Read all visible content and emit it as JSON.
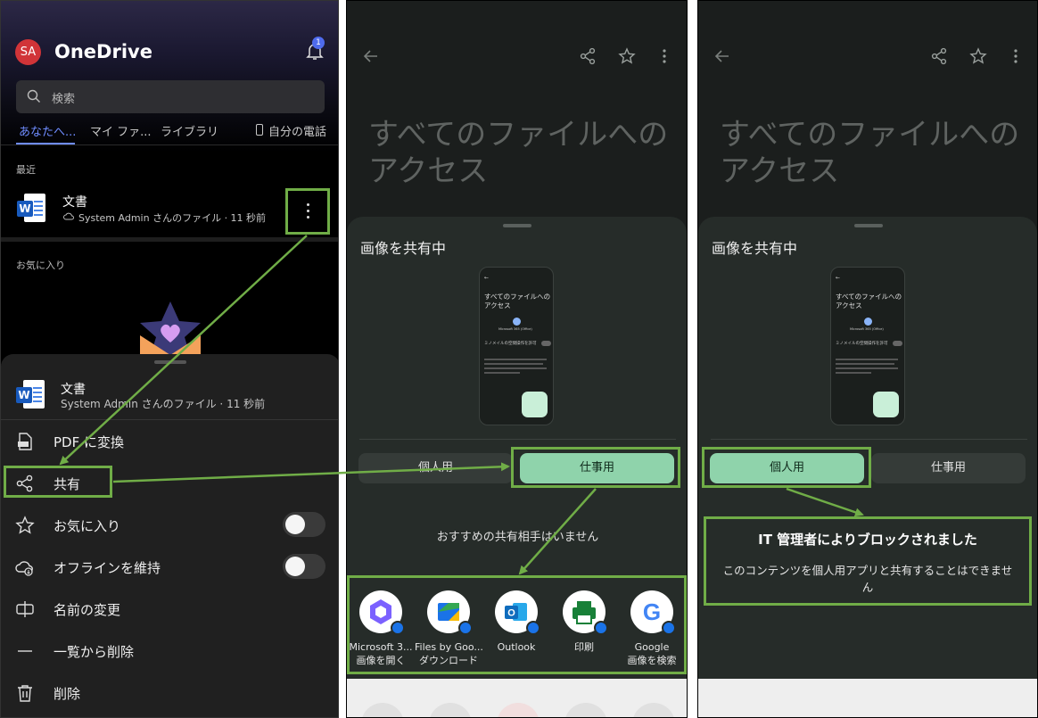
{
  "onedrive": {
    "avatar_initials": "SA",
    "app_title": "OneDrive",
    "notification_count": "1",
    "search_placeholder": "検索",
    "tabs": [
      "あなたへ...",
      "マイ ファ...",
      "ライブラリ",
      "自分の電話"
    ],
    "recent_label": "最近",
    "recent_file": {
      "name": "文書",
      "subtitle": "System Admin さんのファイル · 11 秒前"
    },
    "favorites_label": "お気に入り",
    "sheet": {
      "file_name": "文書",
      "file_subtitle": "System Admin さんのファイル · 11 秒前",
      "menu": [
        {
          "label": "PDF に変換",
          "icon": "pdf-icon"
        },
        {
          "label": "共有",
          "icon": "share-icon"
        },
        {
          "label": "お気に入り",
          "icon": "star-icon",
          "toggle": false
        },
        {
          "label": "オフラインを維持",
          "icon": "offline-icon",
          "toggle": false
        },
        {
          "label": "名前の変更",
          "icon": "rename-icon"
        },
        {
          "label": "一覧から削除",
          "icon": "remove-from-list-icon"
        },
        {
          "label": "削除",
          "icon": "trash-icon"
        }
      ]
    }
  },
  "share_work": {
    "bg_title_line1": "すべてのファイルへの",
    "bg_title_line2": "アクセス",
    "sheet_title": "画像を共有中",
    "thumb": {
      "title1": "すべてのファイルへの",
      "title2": "アクセス",
      "app": "Microsoft 365 (Office)",
      "setting": "ミノメイルの空間操作を許可"
    },
    "segment_personal": "個人用",
    "segment_work": "仕事用",
    "selected": "work",
    "no_recommendations": "おすすめの共有相手はいません",
    "apps": [
      {
        "line1": "Microsoft 3...",
        "line2": "画像を開く",
        "icon": "microsoft365-icon"
      },
      {
        "line1": "Files by Goo...",
        "line2": "ダウンロード",
        "icon": "files-by-google-icon"
      },
      {
        "line1": "Outlook",
        "line2": "",
        "icon": "outlook-icon"
      },
      {
        "line1": "印刷",
        "line2": "",
        "icon": "print-icon"
      },
      {
        "line1": "Google",
        "line2": "画像を検索",
        "icon": "google-icon"
      }
    ]
  },
  "share_personal": {
    "bg_title_line1": "すべてのファイルへの",
    "bg_title_line2": "アクセス",
    "sheet_title": "画像を共有中",
    "segment_personal": "個人用",
    "segment_work": "仕事用",
    "selected": "personal",
    "blocked_title": "IT 管理者によりブロックされました",
    "blocked_message": "このコンテンツを個人用アプリと共有することはできません"
  },
  "colors": {
    "annotation_green": "#70ad47",
    "segment_selected": "#8fd3ab",
    "onedrive_accent": "#6f8cff",
    "avatar_red": "#d13438"
  }
}
